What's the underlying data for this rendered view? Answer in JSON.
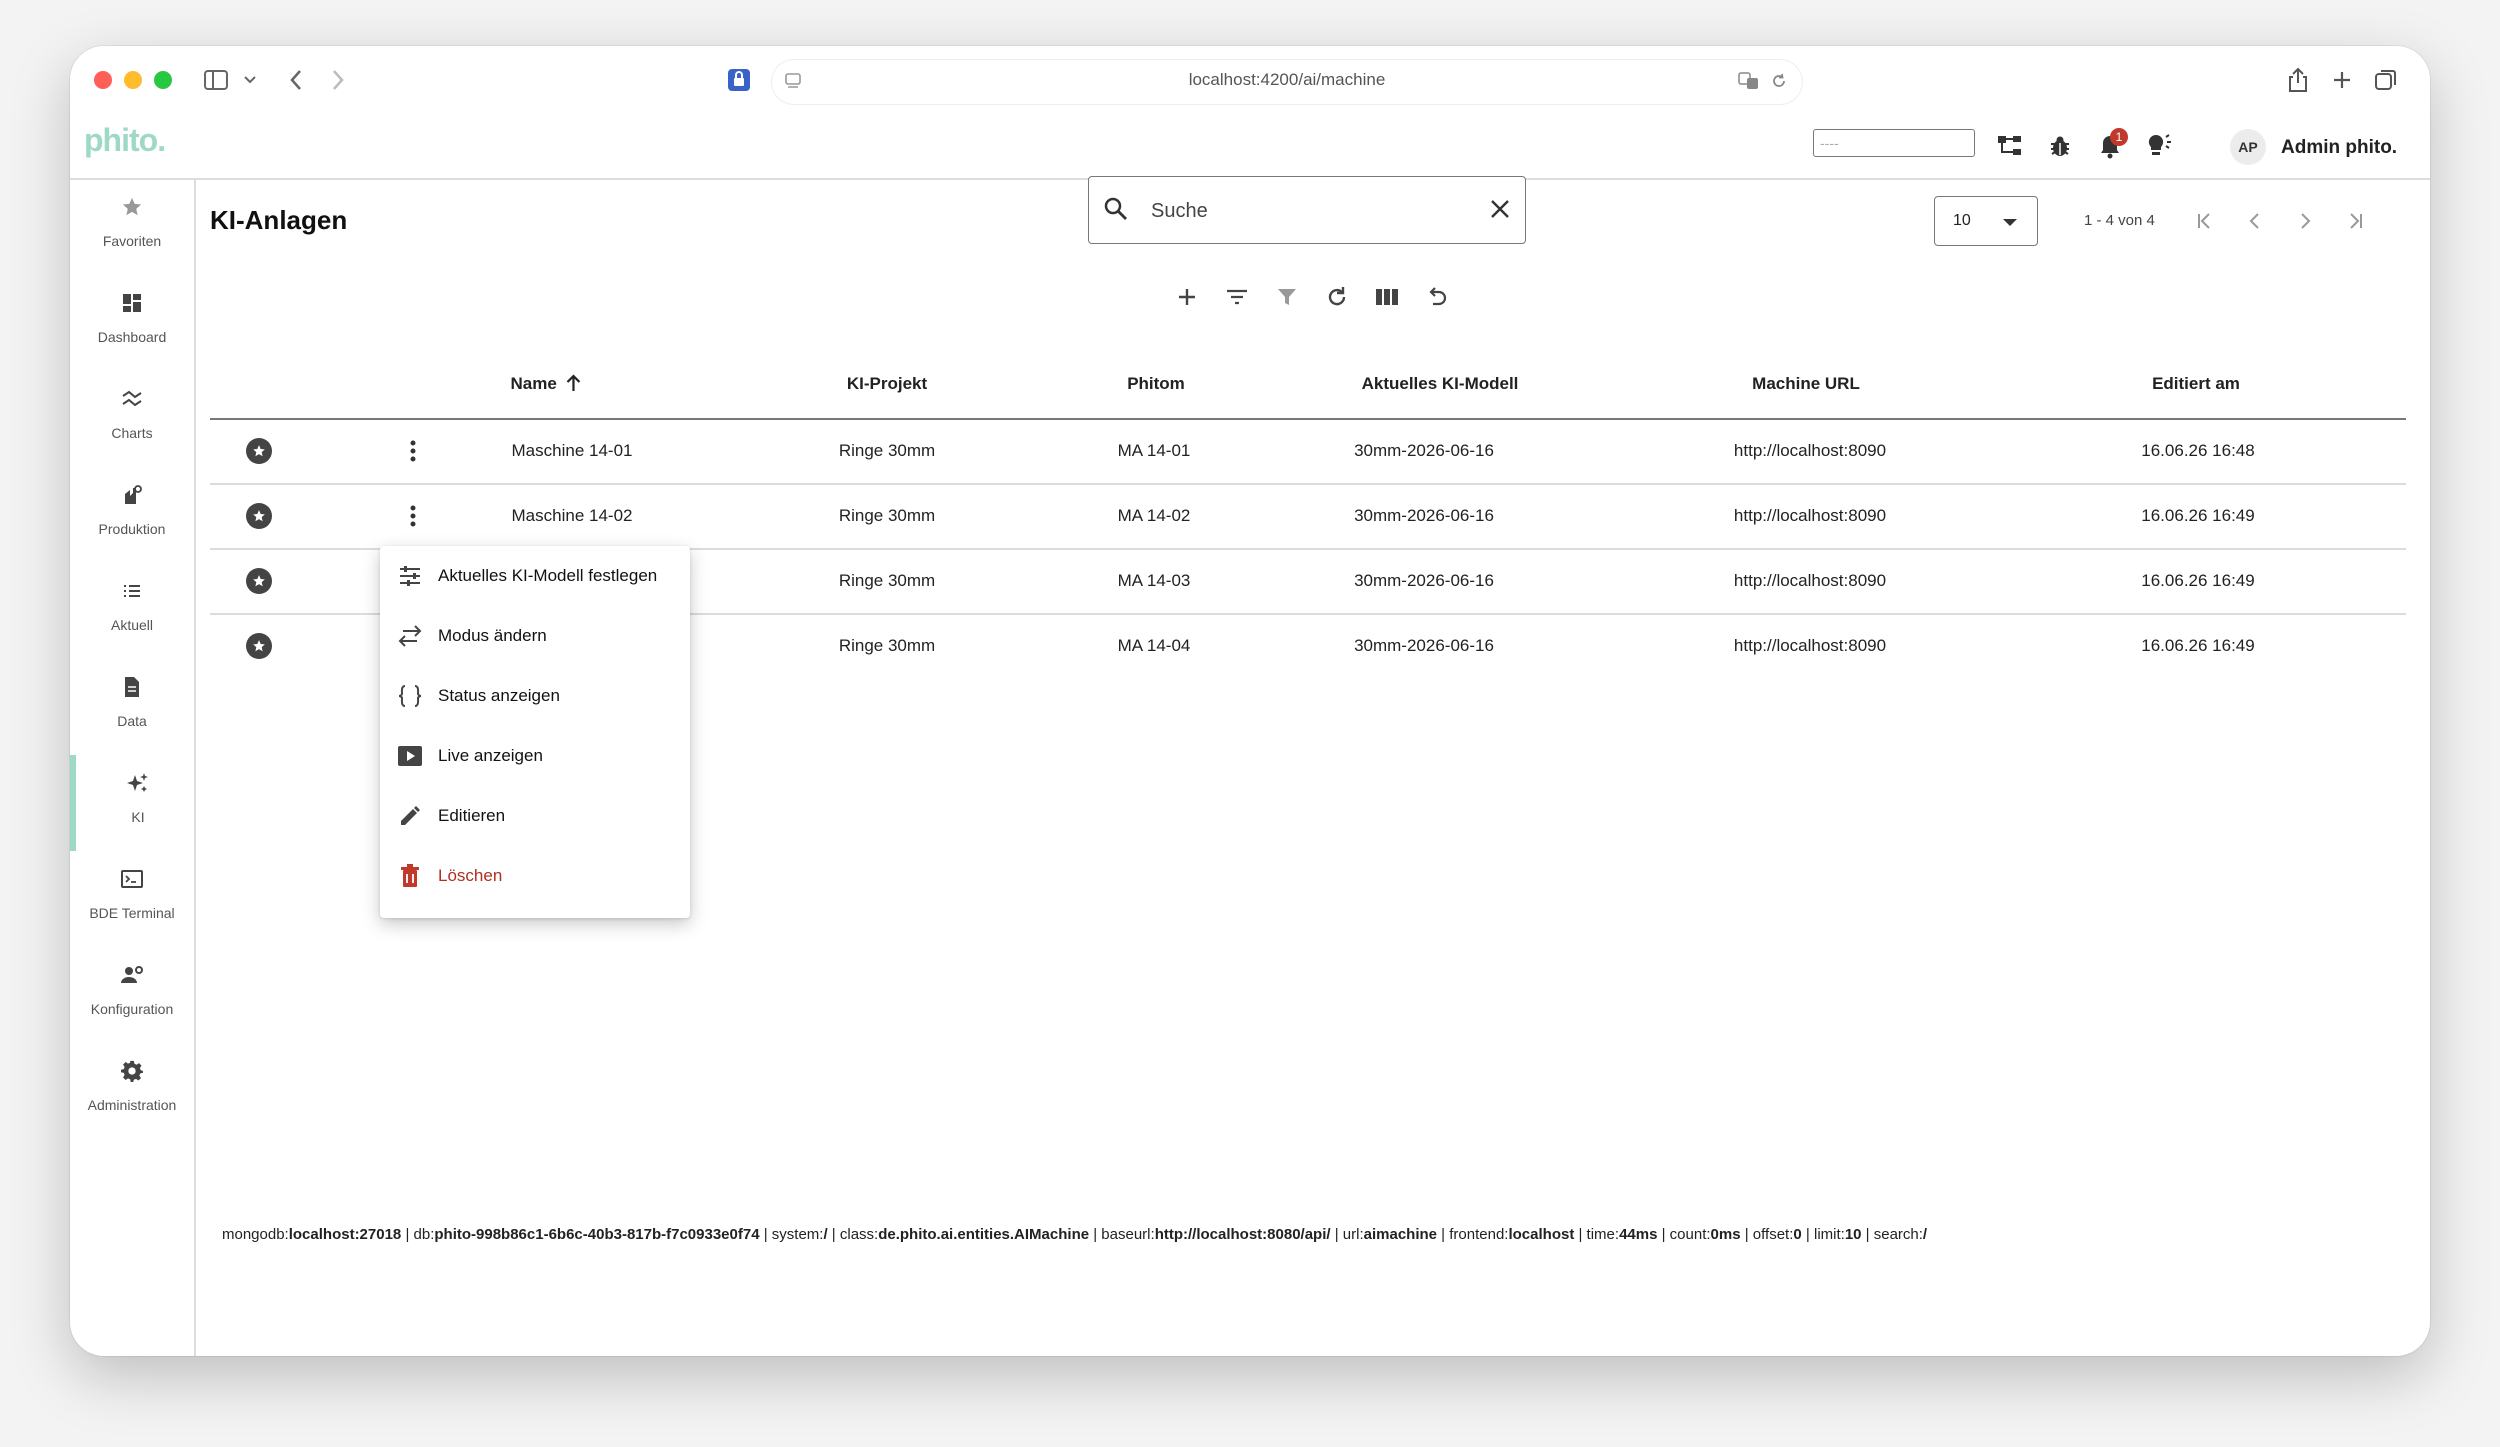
{
  "browser": {
    "url": "localhost:4200/ai/machine"
  },
  "app": {
    "logo": "phito.",
    "header_input_placeholder": "----",
    "notification_count": "1",
    "user_initials": "AP",
    "user_name": "Admin phito."
  },
  "nav": {
    "items": [
      {
        "label": "Favoriten",
        "icon": "star-icon"
      },
      {
        "label": "Dashboard",
        "icon": "dashboard-icon"
      },
      {
        "label": "Charts",
        "icon": "charts-icon"
      },
      {
        "label": "Produktion",
        "icon": "production-icon"
      },
      {
        "label": "Aktuell",
        "icon": "list-icon"
      },
      {
        "label": "Data",
        "icon": "document-icon"
      },
      {
        "label": "KI",
        "icon": "ai-sparkle-icon"
      },
      {
        "label": "BDE Terminal",
        "icon": "terminal-icon"
      },
      {
        "label": "Konfiguration",
        "icon": "user-settings-icon"
      },
      {
        "label": "Administration",
        "icon": "gear-icon"
      }
    ],
    "active": "KI"
  },
  "page": {
    "title": "KI-Anlagen",
    "search_placeholder": "Suche",
    "page_size": "10",
    "range": "1 - 4 von 4"
  },
  "table": {
    "columns": [
      "Name",
      "KI-Projekt",
      "Phitom",
      "Aktuelles KI-Modell",
      "Machine URL",
      "Editiert am"
    ],
    "sort_column": "Name",
    "sort_direction": "asc",
    "rows": [
      {
        "name": "Maschine 14-01",
        "project": "Ringe 30mm",
        "phitom": "MA 14-01",
        "model": "30mm-2026-06-16",
        "url": "http://localhost:8090",
        "edited": "16.06.26 16:48"
      },
      {
        "name": "Maschine 14-02",
        "project": "Ringe 30mm",
        "phitom": "MA 14-02",
        "model": "30mm-2026-06-16",
        "url": "http://localhost:8090",
        "edited": "16.06.26 16:49"
      },
      {
        "name": "",
        "project": "Ringe 30mm",
        "phitom": "MA 14-03",
        "model": "30mm-2026-06-16",
        "url": "http://localhost:8090",
        "edited": "16.06.26 16:49"
      },
      {
        "name": "",
        "project": "Ringe 30mm",
        "phitom": "MA 14-04",
        "model": "30mm-2026-06-16",
        "url": "http://localhost:8090",
        "edited": "16.06.26 16:49"
      }
    ]
  },
  "context_menu": {
    "items": [
      {
        "label": "Aktuelles KI-Modell festlegen",
        "icon": "tune-icon"
      },
      {
        "label": "Modus ändern",
        "icon": "swap-arrows-icon"
      },
      {
        "label": "Status anzeigen",
        "icon": "braces-icon"
      },
      {
        "label": "Live anzeigen",
        "icon": "play-box-icon"
      },
      {
        "label": "Editieren",
        "icon": "pencil-icon"
      },
      {
        "label": "Löschen",
        "icon": "trash-icon"
      }
    ]
  },
  "footer": {
    "mongodb_label": "mongodb:",
    "mongodb": "localhost:27018",
    "db_label": " | db:",
    "db": "phito-998b86c1-6b6c-40b3-817b-f7c0933e0f74",
    "system_label": " | system:",
    "system": "/",
    "class_label": " | class:",
    "class": "de.phito.ai.entities.AIMachine",
    "baseurl_label": " | baseurl:",
    "baseurl": "http://localhost:8080/api/",
    "url_label": " | url:",
    "url": "aimachine",
    "frontend_label": " | frontend:",
    "frontend": "localhost",
    "time_label": " | time:",
    "time": "44ms",
    "count_label": " | count:",
    "count": "0ms",
    "offset_label": " | offset:",
    "offset": "0",
    "limit_label": " | limit:",
    "limit": "10",
    "search_label": " | search:",
    "search": "/"
  },
  "colors": {
    "accent": "#9ed8c7",
    "danger": "#c0392b",
    "badge": "#c0392b"
  }
}
